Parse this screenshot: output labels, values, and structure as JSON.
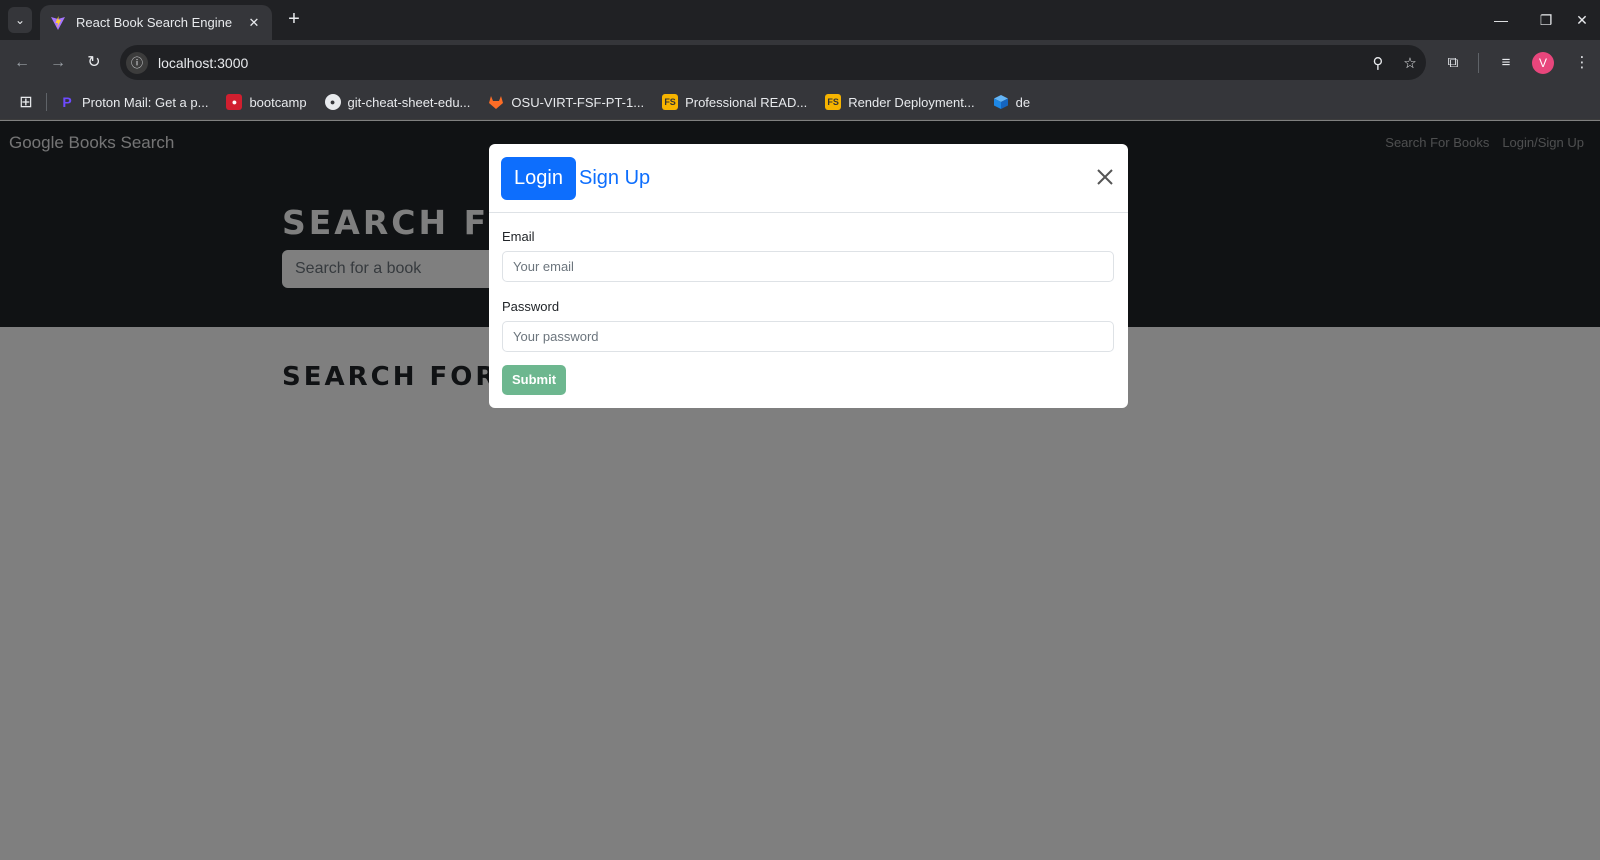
{
  "browser": {
    "tab_title": "React Book Search Engine",
    "url": "localhost:3000",
    "profile_initial": "V",
    "bookmarks": [
      {
        "label": "Proton Mail: Get a p...",
        "icon": "proton-icon",
        "color": "#6d4aff"
      },
      {
        "label": "bootcamp",
        "icon": "bootcamp-icon",
        "color": "#d11f2f"
      },
      {
        "label": "git-cheat-sheet-edu...",
        "icon": "github-icon",
        "color": "#e8eaed"
      },
      {
        "label": "OSU-VIRT-FSF-PT-1...",
        "icon": "gitlab-icon",
        "color": "#fc6d26"
      },
      {
        "label": "Professional READ...",
        "icon": "fs-icon",
        "color": "#f6b400"
      },
      {
        "label": "Render Deployment...",
        "icon": "fs-icon",
        "color": "#f6b400"
      },
      {
        "label": "de",
        "icon": "cube-icon",
        "color": "#1e88e5"
      }
    ]
  },
  "page": {
    "brand": "Google Books Search",
    "nav_links": [
      "Search For Books",
      "Login/Sign Up"
    ],
    "hero_title": "SEARCH F",
    "search_placeholder": "Search for a book",
    "results_title": "SEARCH FOR"
  },
  "modal": {
    "tabs": {
      "login": "Login",
      "signup": "Sign Up"
    },
    "email_label": "Email",
    "email_placeholder": "Your email",
    "password_label": "Password",
    "password_placeholder": "Your password",
    "submit_label": "Submit"
  },
  "colors": {
    "primary": "#0d6efd",
    "submit_disabled": "#6db78f",
    "navbar": "#212529"
  }
}
